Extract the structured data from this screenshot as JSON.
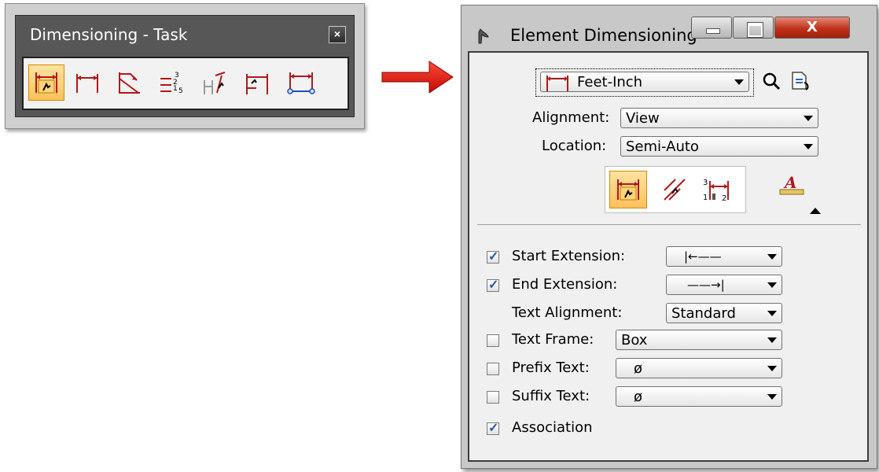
{
  "toolbox": {
    "title": "Dimensioning - Task",
    "close_glyph": "×",
    "tools": [
      {
        "icon": "element-dimension-icon",
        "active": true
      },
      {
        "icon": "linear-size-icon",
        "active": false
      },
      {
        "icon": "angle-size-icon",
        "active": false
      },
      {
        "icon": "ordinate-dimension-icon",
        "active": false
      },
      {
        "icon": "label-line-icon",
        "active": false
      },
      {
        "icon": "linear-stacked-icon",
        "active": false
      },
      {
        "icon": "associative-dimension-icon",
        "active": false
      }
    ]
  },
  "dialog": {
    "title": "Element Dimensioning",
    "close_glyph": "X",
    "style": {
      "value": "Feet-Inch"
    },
    "alignment": {
      "label": "Alignment:",
      "value": "View"
    },
    "location": {
      "label": "Location:",
      "value": "Semi-Auto"
    },
    "modes": [
      "element-dimension-icon",
      "dimension-size-icon",
      "ordinate-mode-icon"
    ],
    "text_style_icon": "text-style-icon",
    "start_extension": {
      "label": "Start Extension:",
      "checked": true,
      "value": "|←——"
    },
    "end_extension": {
      "label": "End Extension:",
      "checked": true,
      "value": "——→|"
    },
    "text_alignment": {
      "label": "Text Alignment:",
      "value": "Standard"
    },
    "text_frame": {
      "label": "Text Frame:",
      "checked": false,
      "value": "Box"
    },
    "prefix_text": {
      "label": "Prefix Text:",
      "checked": false,
      "value": "ø"
    },
    "suffix_text": {
      "label": "Suffix Text:",
      "checked": false,
      "value": "ø"
    },
    "association": {
      "label": "Association",
      "checked": true
    }
  },
  "colors": {
    "accent_red": "#c0231a",
    "active_tool": "#ffc15c",
    "arrow": "#e8140c"
  }
}
